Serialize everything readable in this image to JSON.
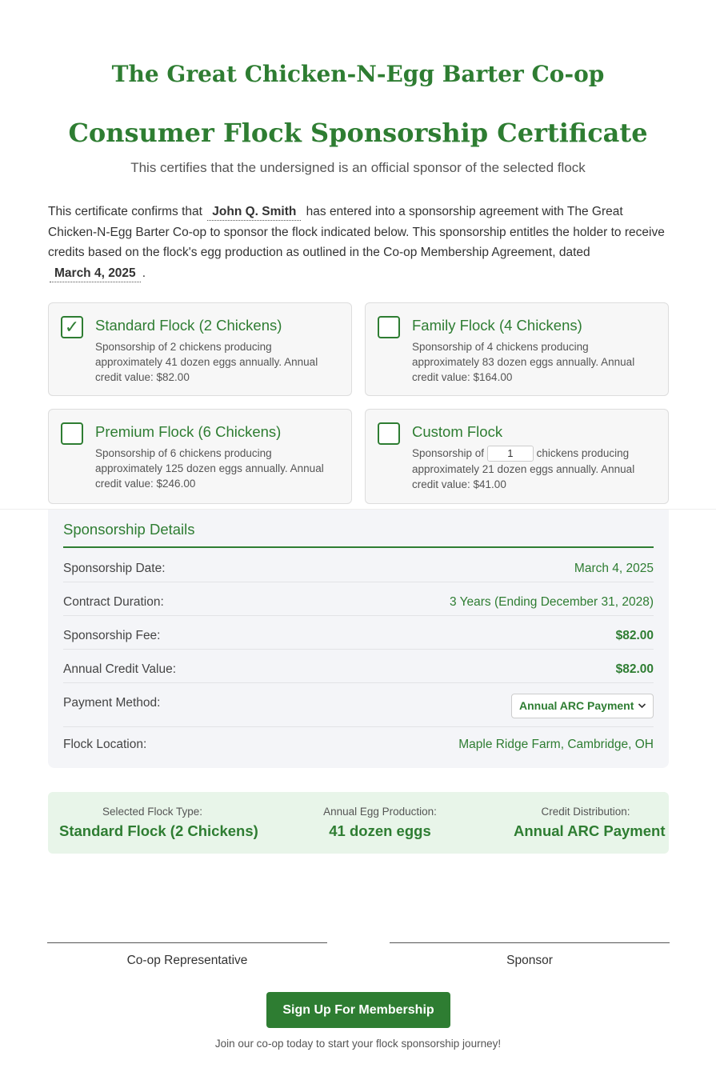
{
  "header": {
    "org_title": "The Great Chicken-N-Egg Barter Co-op",
    "cert_title": "Consumer Flock Sponsorship Certificate",
    "subtitle": "This certifies that the undersigned is an official sponsor of the selected flock"
  },
  "intro": {
    "part1": "This certificate confirms that",
    "sponsor_name": "John Q. Smith",
    "part2": "has entered into a sponsorship agreement with The Great Chicken-N-Egg Barter Co-op to sponsor the flock indicated below. This sponsorship entitles the holder to receive credits based on the flock's egg production as outlined in the Co-op Membership Agreement, dated",
    "agreement_date": "March 4, 2025",
    "end": "."
  },
  "options": [
    {
      "title": "Standard Flock (2 Chickens)",
      "description": "Sponsorship of 2 chickens producing approximately 41 dozen eggs annually. Annual credit value: $82.00",
      "checked": true,
      "check_glyph": "✓"
    },
    {
      "title": "Family Flock (4 Chickens)",
      "description": "Sponsorship of 4 chickens producing approximately 83 dozen eggs annually. Annual credit value: $164.00",
      "checked": false,
      "check_glyph": ""
    },
    {
      "title": "Premium Flock (6 Chickens)",
      "description": "Sponsorship of 6 chickens producing approximately 125 dozen eggs annually. Annual credit value: $246.00",
      "checked": false,
      "check_glyph": ""
    },
    {
      "title": "Custom Flock",
      "desc_before": "Sponsorship of",
      "quantity": "1",
      "desc_after": "chickens producing approximately 21 dozen eggs annually. Annual credit value: $41.00",
      "checked": false,
      "check_glyph": ""
    }
  ],
  "details": {
    "heading": "Sponsorship Details",
    "rows": [
      {
        "label": "Sponsorship Date:",
        "value": "March 4, 2025"
      },
      {
        "label": "Contract Duration:",
        "value": "3 Years (Ending December 31, 2028)"
      },
      {
        "label": "Sponsorship Fee:",
        "value": "$82.00"
      },
      {
        "label": "Annual Credit Value:",
        "value": "$82.00"
      },
      {
        "label": "Payment Method:",
        "value": "Annual ARC Payment"
      },
      {
        "label": "Flock Location:",
        "value": "Maple Ridge Farm, Cambridge, OH"
      }
    ]
  },
  "summary": {
    "flock_type_label": "Selected Flock Type:",
    "flock_type_value": "Standard Flock (2 Chickens)",
    "production_label": "Annual Egg Production:",
    "production_value": "41 dozen eggs",
    "distribution_label": "Credit Distribution:",
    "distribution_value": "Annual ARC Payment"
  },
  "signatures": {
    "rep_label": "Co-op Representative",
    "sponsor_label": "Sponsor"
  },
  "cta": {
    "button_label": "Sign Up For Membership",
    "note": "Join our co-op today to start your flock sponsorship journey!"
  },
  "icons": {
    "select_chevron": "chevron-down-icon",
    "checkbox_check": "check-icon"
  },
  "colors": {
    "brand_green": "#2e7d32",
    "summary_bg": "#e8f5e9",
    "details_bg": "#f4f5f8"
  }
}
